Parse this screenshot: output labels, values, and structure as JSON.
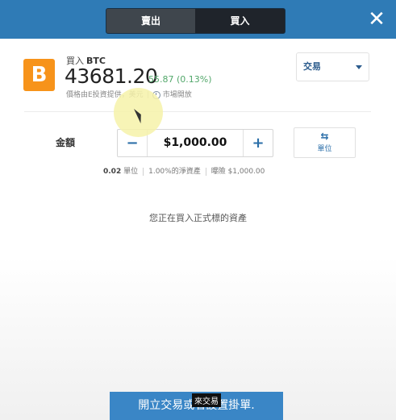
{
  "header": {
    "tabs": [
      {
        "label": "賣出",
        "selected": true
      },
      {
        "label": "買入",
        "selected": false
      }
    ],
    "close_icon": "close-icon"
  },
  "asset": {
    "icon": "bitcoin-icon",
    "icon_glyph": "B",
    "action_label": "買入",
    "symbol": "BTC",
    "price": "43681.20",
    "change": "55.87 (0.13%)",
    "source_text": "價格由E投資提供，美元",
    "market_status": "市場開放"
  },
  "order_type": {
    "selected": "交易",
    "icon": "caret-down-icon"
  },
  "amount": {
    "label": "金額",
    "value": "$1,000.00",
    "minus_icon": "minus-icon",
    "plus_icon": "plus-icon",
    "unit_toggle_icon": "swap-icon",
    "unit_toggle_label": "單位"
  },
  "summary": {
    "units_value": "0.02",
    "units_label": "單位",
    "equity_pct": "1.00%的淨資產",
    "exposure": "曝險 $1,000.00"
  },
  "info_text": "您正在買入正式標的資產",
  "cta": {
    "label": "開立交易或者設置掛單."
  },
  "overlay_caption": "來交易",
  "colors": {
    "topbar": "#2f7bb6",
    "accent_blue": "#2a6ea8",
    "bitcoin_orange": "#f7931a",
    "change_green": "#53a86b",
    "cta_blue": "#3a86c6"
  }
}
